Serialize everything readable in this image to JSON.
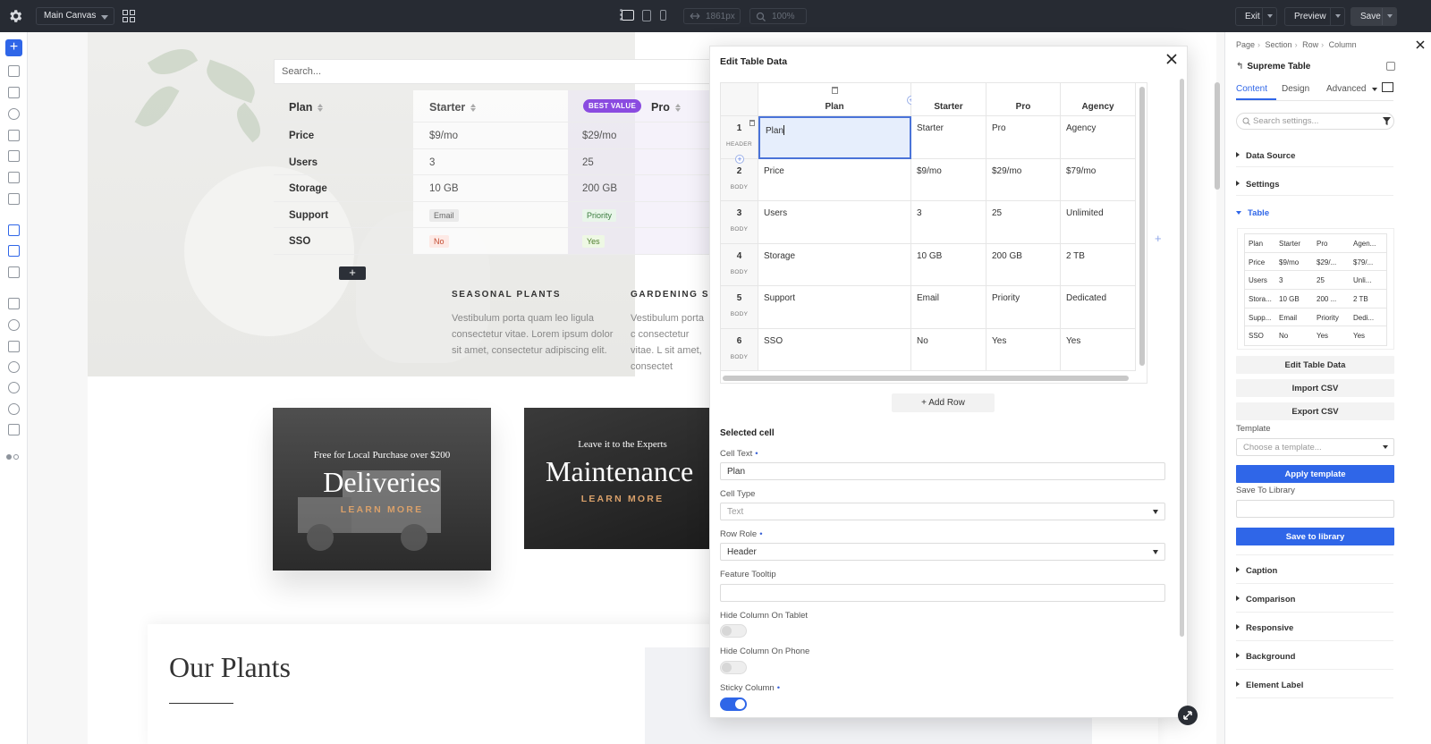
{
  "toolbar": {
    "canvas_name": "Main Canvas",
    "width_value": "1861px",
    "zoom_value": "100%",
    "exit_label": "Exit",
    "preview_label": "Preview",
    "save_label": "Save"
  },
  "canvas": {
    "search_placeholder": "Search...",
    "pricing_header": [
      "Plan",
      "Starter",
      "Pro"
    ],
    "best_value_badge": "BEST VALUE",
    "pricing_rows": [
      {
        "label": "Price",
        "starter": "$9/mo",
        "pro": "$29/mo"
      },
      {
        "label": "Users",
        "starter": "3",
        "pro": "25"
      },
      {
        "label": "Storage",
        "starter": "10 GB",
        "pro": "200 GB"
      },
      {
        "label": "Support",
        "starter": "Email",
        "pro": "Priority"
      },
      {
        "label": "SSO",
        "starter": "No",
        "pro": "Yes"
      }
    ],
    "add_row_glyph": "+",
    "seasonal_title": "SEASONAL PLANTS",
    "seasonal_text": "Vestibulum porta quam leo ligula consectetur vitae. Lorem ipsum dolor sit amet, consectetur adipiscing elit.",
    "gardening_title": "GARDENING SER",
    "gardening_text": "Vestibulum porta c consectetur vitae. L sit amet, consectet",
    "promo1": {
      "small": "Free for Local Purchase over $200",
      "big": "Deliveries",
      "cta": "LEARN MORE"
    },
    "promo2": {
      "small": "Leave it to the Experts",
      "big": "Maintenance",
      "cta": "LEARN MORE"
    },
    "section_title": "Our Plants"
  },
  "modal": {
    "title": "Edit Table Data",
    "columns": [
      "Plan",
      "Starter",
      "Pro",
      "Agency"
    ],
    "rows": [
      {
        "num": "1",
        "role": "HEADER",
        "cells": [
          "Plan",
          "Starter",
          "Pro",
          "Agency"
        ]
      },
      {
        "num": "2",
        "role": "BODY",
        "cells": [
          "Price",
          "$9/mo",
          "$29/mo",
          "$79/mo"
        ]
      },
      {
        "num": "3",
        "role": "BODY",
        "cells": [
          "Users",
          "3",
          "25",
          "Unlimited"
        ]
      },
      {
        "num": "4",
        "role": "BODY",
        "cells": [
          "Storage",
          "10 GB",
          "200 GB",
          "2 TB"
        ]
      },
      {
        "num": "5",
        "role": "BODY",
        "cells": [
          "Support",
          "Email",
          "Priority",
          "Dedicated"
        ]
      },
      {
        "num": "6",
        "role": "BODY",
        "cells": [
          "SSO",
          "No",
          "Yes",
          "Yes"
        ]
      }
    ],
    "add_row_label": "Add Row",
    "selected_cell_title": "Selected cell",
    "cell_text_label": "Cell Text",
    "cell_text_value": "Plan",
    "cell_type_label": "Cell Type",
    "cell_type_placeholder": "Text",
    "row_role_label": "Row Role",
    "row_role_value": "Header",
    "feature_tooltip_label": "Feature Tooltip",
    "feature_tooltip_value": "",
    "hide_tablet_label": "Hide Column On Tablet",
    "hide_tablet_on": false,
    "hide_phone_label": "Hide Column On Phone",
    "hide_phone_on": false,
    "sticky_label": "Sticky Column",
    "sticky_on": true
  },
  "panel": {
    "breadcrumb": [
      "Page",
      "Section",
      "Row",
      "Column"
    ],
    "title": "Supreme Table",
    "tabs": [
      "Content",
      "Design",
      "Advanced"
    ],
    "active_tab": "Content",
    "search_placeholder": "Search settings...",
    "sections_top": [
      "Data Source",
      "Settings",
      "Table"
    ],
    "mini_table": [
      [
        "Plan",
        "Starter",
        "Pro",
        "Agen..."
      ],
      [
        "Price",
        "$9/mo",
        "$29/...",
        "$79/..."
      ],
      [
        "Users",
        "3",
        "25",
        "Unli..."
      ],
      [
        "Stora...",
        "10 GB",
        "200 ...",
        "2 TB"
      ],
      [
        "Supp...",
        "Email",
        "Priority",
        "Dedi..."
      ],
      [
        "SSO",
        "No",
        "Yes",
        "Yes"
      ]
    ],
    "edit_table_btn": "Edit Table Data",
    "import_csv_btn": "Import CSV",
    "export_csv_btn": "Export CSV",
    "template_label": "Template",
    "template_placeholder": "Choose a template...",
    "apply_template_btn": "Apply template",
    "save_library_label": "Save To Library",
    "save_library_btn": "Save to library",
    "sections_bottom": [
      "Caption",
      "Comparison",
      "Responsive",
      "Background",
      "Element Label"
    ]
  },
  "colors": {
    "accent": "#2f66e8",
    "topbar": "#272b33",
    "badge": "#8a4be0"
  }
}
